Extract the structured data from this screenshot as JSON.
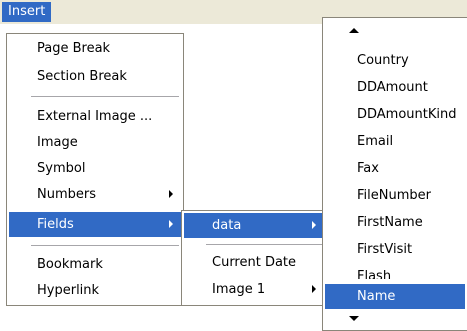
{
  "menubar": {
    "insert_label": "Insert"
  },
  "insert_menu": {
    "items": [
      {
        "label": "Page Break"
      },
      {
        "label": "Section Break"
      },
      {
        "label": "External Image ..."
      },
      {
        "label": "Image"
      },
      {
        "label": "Symbol"
      },
      {
        "label": "Numbers"
      },
      {
        "label": "Fields"
      },
      {
        "label": "Bookmark"
      },
      {
        "label": "Hyperlink"
      }
    ]
  },
  "fields_menu": {
    "items": [
      {
        "label": "data"
      },
      {
        "label": "Current Date"
      },
      {
        "label": "Image 1"
      }
    ]
  },
  "data_menu": {
    "items": [
      {
        "label": "Country"
      },
      {
        "label": "DDAmount"
      },
      {
        "label": "DDAmountKind"
      },
      {
        "label": "Email"
      },
      {
        "label": "Fax"
      },
      {
        "label": "FileNumber"
      },
      {
        "label": "FirstName"
      },
      {
        "label": "FirstVisit"
      },
      {
        "label": "Flash"
      },
      {
        "label": "Name"
      }
    ]
  },
  "colors": {
    "highlight": "#316ac5",
    "menubar_bg": "#ece9d8",
    "border": "#8a867a"
  }
}
